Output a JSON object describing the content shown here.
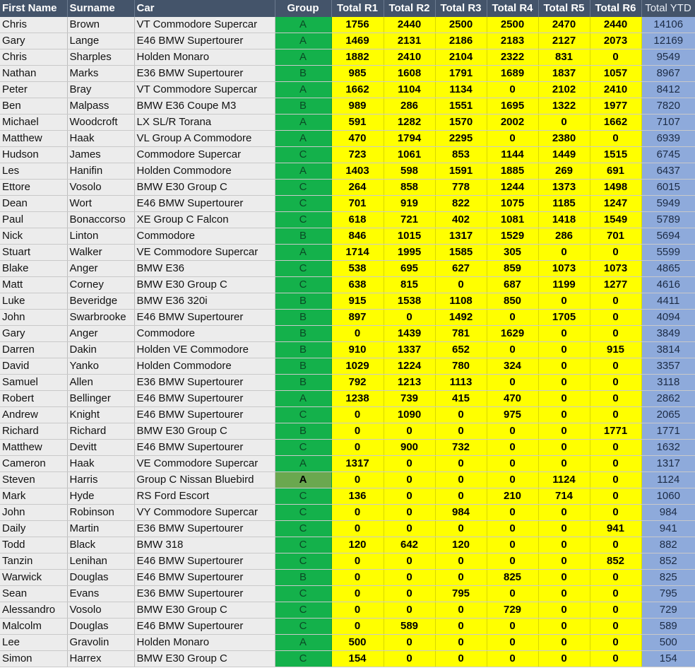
{
  "headers": {
    "first_name": "First Name",
    "surname": "Surname",
    "car": "Car",
    "group": "Group",
    "r1": "Total R1",
    "r2": "Total R2",
    "r3": "Total R3",
    "r4": "Total R4",
    "r5": "Total R5",
    "r6": "Total R6",
    "ytd": "Total YTD"
  },
  "colors": {
    "header_bg": "#44546a",
    "name_bg": "#ececec",
    "group_bg": "#14b14b",
    "group_highlight_bg": "#6aa84f",
    "round_bg": "#ffff00",
    "ytd_bg": "#8eaadb"
  },
  "rows": [
    {
      "first": "Chris",
      "surname": "Brown",
      "car": "VT Commodore Supercar",
      "group": "A",
      "r1": "1756",
      "r2": "2440",
      "r3": "2500",
      "r4": "2500",
      "r5": "2470",
      "r6": "2440",
      "ytd": "14106"
    },
    {
      "first": "Gary",
      "surname": "Lange",
      "car": "E46 BMW Supertourer",
      "group": "A",
      "r1": "1469",
      "r2": "2131",
      "r3": "2186",
      "r4": "2183",
      "r5": "2127",
      "r6": "2073",
      "ytd": "12169"
    },
    {
      "first": "Chris",
      "surname": "Sharples",
      "car": "Holden Monaro",
      "group": "A",
      "r1": "1882",
      "r2": "2410",
      "r3": "2104",
      "r4": "2322",
      "r5": "831",
      "r6": "0",
      "ytd": "9549"
    },
    {
      "first": "Nathan",
      "surname": "Marks",
      "car": "E36 BMW Supertourer",
      "group": "B",
      "r1": "985",
      "r2": "1608",
      "r3": "1791",
      "r4": "1689",
      "r5": "1837",
      "r6": "1057",
      "ytd": "8967"
    },
    {
      "first": "Peter",
      "surname": "Bray",
      "car": "VT Commodore Supercar",
      "group": "A",
      "r1": "1662",
      "r2": "1104",
      "r3": "1134",
      "r4": "0",
      "r5": "2102",
      "r6": "2410",
      "ytd": "8412"
    },
    {
      "first": "Ben",
      "surname": "Malpass",
      "car": "BMW E36 Coupe M3",
      "group": "B",
      "r1": "989",
      "r2": "286",
      "r3": "1551",
      "r4": "1695",
      "r5": "1322",
      "r6": "1977",
      "ytd": "7820"
    },
    {
      "first": "Michael",
      "surname": "Woodcroft",
      "car": "LX SL/R Torana",
      "group": "A",
      "r1": "591",
      "r2": "1282",
      "r3": "1570",
      "r4": "2002",
      "r5": "0",
      "r6": "1662",
      "ytd": "7107"
    },
    {
      "first": "Matthew",
      "surname": "Haak",
      "car": "VL Group A Commodore",
      "group": "A",
      "r1": "470",
      "r2": "1794",
      "r3": "2295",
      "r4": "0",
      "r5": "2380",
      "r6": "0",
      "ytd": "6939"
    },
    {
      "first": "Hudson",
      "surname": "James",
      "car": "Commodore Supercar",
      "group": "C",
      "r1": "723",
      "r2": "1061",
      "r3": "853",
      "r4": "1144",
      "r5": "1449",
      "r6": "1515",
      "ytd": "6745"
    },
    {
      "first": "Les",
      "surname": "Hanifin",
      "car": "Holden Commodore",
      "group": "A",
      "r1": "1403",
      "r2": "598",
      "r3": "1591",
      "r4": "1885",
      "r5": "269",
      "r6": "691",
      "ytd": "6437"
    },
    {
      "first": "Ettore",
      "surname": "Vosolo",
      "car": "BMW  E30 Group C",
      "group": "C",
      "r1": "264",
      "r2": "858",
      "r3": "778",
      "r4": "1244",
      "r5": "1373",
      "r6": "1498",
      "ytd": "6015"
    },
    {
      "first": "Dean",
      "surname": "Wort",
      "car": "E46 BMW Supertourer",
      "group": "C",
      "r1": "701",
      "r2": "919",
      "r3": "822",
      "r4": "1075",
      "r5": "1185",
      "r6": "1247",
      "ytd": "5949"
    },
    {
      "first": "Paul",
      "surname": "Bonaccorso",
      "car": "XE Group C Falcon",
      "group": "C",
      "r1": "618",
      "r2": "721",
      "r3": "402",
      "r4": "1081",
      "r5": "1418",
      "r6": "1549",
      "ytd": "5789"
    },
    {
      "first": "Nick",
      "surname": "Linton",
      "car": "Commodore",
      "group": "B",
      "r1": "846",
      "r2": "1015",
      "r3": "1317",
      "r4": "1529",
      "r5": "286",
      "r6": "701",
      "ytd": "5694"
    },
    {
      "first": "Stuart",
      "surname": "Walker",
      "car": "VE Commodore Supercar",
      "group": "A",
      "r1": "1714",
      "r2": "1995",
      "r3": "1585",
      "r4": "305",
      "r5": "0",
      "r6": "0",
      "ytd": "5599"
    },
    {
      "first": "Blake",
      "surname": "Anger",
      "car": "BMW E36",
      "group": "C",
      "r1": "538",
      "r2": "695",
      "r3": "627",
      "r4": "859",
      "r5": "1073",
      "r6": "1073",
      "ytd": "4865"
    },
    {
      "first": "Matt",
      "surname": "Corney",
      "car": "BMW  E30 Group C",
      "group": "C",
      "r1": "638",
      "r2": "815",
      "r3": "0",
      "r4": "687",
      "r5": "1199",
      "r6": "1277",
      "ytd": "4616"
    },
    {
      "first": "Luke",
      "surname": "Beveridge",
      "car": "BMW E36 320i",
      "group": "B",
      "r1": "915",
      "r2": "1538",
      "r3": "1108",
      "r4": "850",
      "r5": "0",
      "r6": "0",
      "ytd": "4411"
    },
    {
      "first": "John",
      "surname": "Swarbrooke",
      "car": "E46 BMW Supertourer",
      "group": "B",
      "r1": "897",
      "r2": "0",
      "r3": "1492",
      "r4": "0",
      "r5": "1705",
      "r6": "0",
      "ytd": "4094"
    },
    {
      "first": "Gary",
      "surname": "Anger",
      "car": "Commodore",
      "group": "B",
      "r1": "0",
      "r2": "1439",
      "r3": "781",
      "r4": "1629",
      "r5": "0",
      "r6": "0",
      "ytd": "3849"
    },
    {
      "first": "Darren",
      "surname": "Dakin",
      "car": "Holden VE Commodore",
      "group": "B",
      "r1": "910",
      "r2": "1337",
      "r3": "652",
      "r4": "0",
      "r5": "0",
      "r6": "915",
      "ytd": "3814"
    },
    {
      "first": "David",
      "surname": "Yanko",
      "car": "Holden Commodore",
      "group": "B",
      "r1": "1029",
      "r2": "1224",
      "r3": "780",
      "r4": "324",
      "r5": "0",
      "r6": "0",
      "ytd": "3357"
    },
    {
      "first": "Samuel",
      "surname": "Allen",
      "car": "E36 BMW Supertourer",
      "group": "B",
      "r1": "792",
      "r2": "1213",
      "r3": "1113",
      "r4": "0",
      "r5": "0",
      "r6": "0",
      "ytd": "3118"
    },
    {
      "first": "Robert",
      "surname": "Bellinger",
      "car": "E46 BMW Supertourer",
      "group": "A",
      "r1": "1238",
      "r2": "739",
      "r3": "415",
      "r4": "470",
      "r5": "0",
      "r6": "0",
      "ytd": "2862"
    },
    {
      "first": "Andrew",
      "surname": "Knight",
      "car": "E46 BMW Supertourer",
      "group": "C",
      "r1": "0",
      "r2": "1090",
      "r3": "0",
      "r4": "975",
      "r5": "0",
      "r6": "0",
      "ytd": "2065"
    },
    {
      "first": "Richard",
      "surname": "Richard",
      "car": "BMW E30 Group C",
      "group": "B",
      "r1": "0",
      "r2": "0",
      "r3": "0",
      "r4": "0",
      "r5": "0",
      "r6": "1771",
      "ytd": "1771"
    },
    {
      "first": "Matthew",
      "surname": "Devitt",
      "car": "E46 BMW Supertourer",
      "group": "C",
      "r1": "0",
      "r2": "900",
      "r3": "732",
      "r4": "0",
      "r5": "0",
      "r6": "0",
      "ytd": "1632"
    },
    {
      "first": "Cameron",
      "surname": "Haak",
      "car": "VE Commodore Supercar",
      "group": "A",
      "r1": "1317",
      "r2": "0",
      "r3": "0",
      "r4": "0",
      "r5": "0",
      "r6": "0",
      "ytd": "1317"
    },
    {
      "first": "Steven",
      "surname": "Harris",
      "car": "Group C Nissan Bluebird",
      "group": "A",
      "group_highlight": true,
      "r1": "0",
      "r2": "0",
      "r3": "0",
      "r4": "0",
      "r5": "1124",
      "r6": "0",
      "ytd": "1124"
    },
    {
      "first": "Mark",
      "surname": "Hyde",
      "car": "RS Ford Escort",
      "group": "C",
      "r1": "136",
      "r2": "0",
      "r3": "0",
      "r4": "210",
      "r5": "714",
      "r6": "0",
      "ytd": "1060"
    },
    {
      "first": "John",
      "surname": "Robinson",
      "car": "VY Commodore Supercar",
      "group": "C",
      "r1": "0",
      "r2": "0",
      "r3": "984",
      "r4": "0",
      "r5": "0",
      "r6": "0",
      "ytd": "984"
    },
    {
      "first": "Daily",
      "surname": "Martin",
      "car": "E36 BMW Supertourer",
      "group": "C",
      "r1": "0",
      "r2": "0",
      "r3": "0",
      "r4": "0",
      "r5": "0",
      "r6": "941",
      "ytd": "941"
    },
    {
      "first": "Todd",
      "surname": "Black",
      "car": "BMW 318",
      "group": "C",
      "r1": "120",
      "r2": "642",
      "r3": "120",
      "r4": "0",
      "r5": "0",
      "r6": "0",
      "ytd": "882"
    },
    {
      "first": "Tanzin",
      "surname": "Lenihan",
      "car": "E46 BMW Supertourer",
      "group": "C",
      "r1": "0",
      "r2": "0",
      "r3": "0",
      "r4": "0",
      "r5": "0",
      "r6": "852",
      "ytd": "852"
    },
    {
      "first": "Warwick",
      "surname": "Douglas",
      "car": "E46 BMW Supertourer",
      "group": "B",
      "r1": "0",
      "r2": "0",
      "r3": "0",
      "r4": "825",
      "r5": "0",
      "r6": "0",
      "ytd": "825"
    },
    {
      "first": "Sean",
      "surname": "Evans",
      "car": "E36 BMW Supertourer",
      "group": "C",
      "r1": "0",
      "r2": "0",
      "r3": "795",
      "r4": "0",
      "r5": "0",
      "r6": "0",
      "ytd": "795"
    },
    {
      "first": "Alessandro",
      "surname": "Vosolo",
      "car": "BMW  E30 Group C",
      "group": "C",
      "r1": "0",
      "r2": "0",
      "r3": "0",
      "r4": "729",
      "r5": "0",
      "r6": "0",
      "ytd": "729"
    },
    {
      "first": "Malcolm",
      "surname": "Douglas",
      "car": "E46 BMW Supertourer",
      "group": "C",
      "r1": "0",
      "r2": "589",
      "r3": "0",
      "r4": "0",
      "r5": "0",
      "r6": "0",
      "ytd": "589"
    },
    {
      "first": "Lee",
      "surname": "Gravolin",
      "car": "Holden Monaro",
      "group": "A",
      "r1": "500",
      "r2": "0",
      "r3": "0",
      "r4": "0",
      "r5": "0",
      "r6": "0",
      "ytd": "500"
    },
    {
      "first": "Simon",
      "surname": "Harrex",
      "car": "BMW E30 Group C",
      "group": "C",
      "r1": "154",
      "r2": "0",
      "r3": "0",
      "r4": "0",
      "r5": "0",
      "r6": "0",
      "ytd": "154"
    }
  ]
}
